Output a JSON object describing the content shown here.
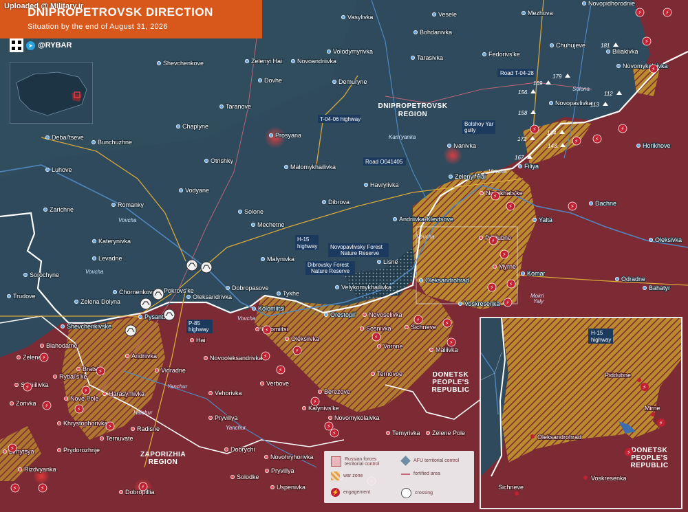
{
  "header": {
    "upload_note": "Uploaded @ Military.ir",
    "title": "DNIPROPETROVSK DIRECTION",
    "subtitle": "Situation by the end of August 31, 2026",
    "brand": "@RYBAR"
  },
  "colors": {
    "afu_territory": "#2e4a5c",
    "russian_territory": "#7c2a33",
    "war_zone": "#c8902d",
    "title_bg": "#d8581c",
    "engagement": "#c02030",
    "road": "#d9a93a"
  },
  "regions": {
    "dnipropetrovsk": "DNIPROPETROVSK\nREGION",
    "donetsk": "DONETSK\nPEOPLE'S\nREPUBLIC",
    "zaporizhia": "ZAPORIZHIA\nREGION"
  },
  "rivers": [
    "Vovcha",
    "Vovcha",
    "Vovcha",
    "Vovcha",
    "Vovcha",
    "Kam'yanka",
    "Yanchur",
    "Yanchur",
    "Haichur",
    "Solona",
    "Mokri Yaly"
  ],
  "roads": {
    "t0428": "Road T-04-28",
    "t0406": "T-04-06 highway",
    "o041405": "Road O041405",
    "h15": "H-15\nhighway",
    "p85": "P-85\nhighway",
    "bolshoy_yar": "Bolshoy Yar\ngully",
    "novopavlivsky": "Novopavlivsky Forest\nNature Reserve",
    "dibrovsky": "Dibrovsky Forest\nNature Reserve"
  },
  "settlements_afu": [
    "Vasylivka",
    "Mezhova",
    "Novopidhorodnie",
    "Vesele",
    "Volodymyrivka",
    "Bohdanivka",
    "Zelenyi Hai",
    "Novoandriivka",
    "Tarasivka",
    "Fedorivs'ke",
    "Chuhujeve",
    "Biliakivka",
    "Novomykolaivka",
    "Shevchenkove",
    "Dovhe",
    "Demuryne",
    "Taranove",
    "Novopavlivka",
    "Chaplyne",
    "Prosyana",
    "Debal'tseve",
    "Bunchuzhne",
    "Otrishky",
    "Ivanivka",
    "Horikhove",
    "Malomykhailivka",
    "Luhove",
    "Vodyane",
    "Havrylivka",
    "Filiya",
    "Zelenyi Hai",
    "Romanky",
    "Zarichne",
    "Dibrova",
    "Dachne",
    "Solone",
    "Mechetne",
    "Andriivka-Klevtsove",
    "Yalta",
    "Katerynivka",
    "Levadne",
    "Malynivka",
    "Oleksivka",
    "Sorochyne",
    "Pokrovs'ke",
    "Lisne",
    "Trudove",
    "Chornenkove",
    "Velykomykhailivka",
    "Oleksandrohrad",
    "Komar",
    "Odradne",
    "Bahatyr",
    "Zelena Dolyna",
    "Oleksandrivka",
    "Dobropasove",
    "Tykhe",
    "Kolomiitsi",
    "Voskresenka",
    "Shevchenkivske",
    "Pysantsi",
    "Orestopil'"
  ],
  "settlements_ru": [
    "Novokhats'ke",
    "Piddubne",
    "Myrne",
    "Novoselivka",
    "Sichneve",
    "Hai",
    "Sosnivka",
    "Blahodatne",
    "Oleksiivka",
    "Vorone",
    "Maliivka",
    "Zelene",
    "Andriivka",
    "Novooleksandrivka",
    "Bratske",
    "Rybal's'ke",
    "Vidradne",
    "Ternovoe",
    "Samiilivka",
    "Verbove",
    "Berezove",
    "Harasymivka",
    "Vehorivka",
    "Nove Pole",
    "Zorivka",
    "Kalynivs'ke",
    "Khrystophorivka",
    "Pryvillya",
    "Novomykolaivka",
    "Ternuvate",
    "Radisne",
    "Temyrivka",
    "Zelene Pole",
    "Zirnytsya",
    "Prydorozhnje",
    "Dobrychi",
    "Novohryhorivka",
    "Rizdvyanka",
    "Pryvillya",
    "Solodke",
    "Dobropillia",
    "Uspenivka",
    "Kolomiitsi"
  ],
  "height_numbers": [
    "181",
    "179",
    "169",
    "112",
    "156.",
    "113",
    "158",
    "134",
    "172",
    "143.",
    "167"
  ],
  "inset": {
    "road": "H-15\nhighway",
    "piddubne": "Piddubne",
    "myrne": "Mirne",
    "oleksandrohrad": "Oleksandrohrad",
    "sichneve": "Sichneve",
    "voskresenka": "Voskresenka",
    "donetsk": "DONETSK\nPEOPLE'S\nREPUBLIC"
  },
  "legend": {
    "russian": "Russian forces territorial control",
    "afu": "AFU territorial control",
    "war_zone": "war zone",
    "fortified": "fortified area",
    "engagement": "engagement",
    "crossing": "crossing"
  },
  "watermark": "@RYBAR"
}
